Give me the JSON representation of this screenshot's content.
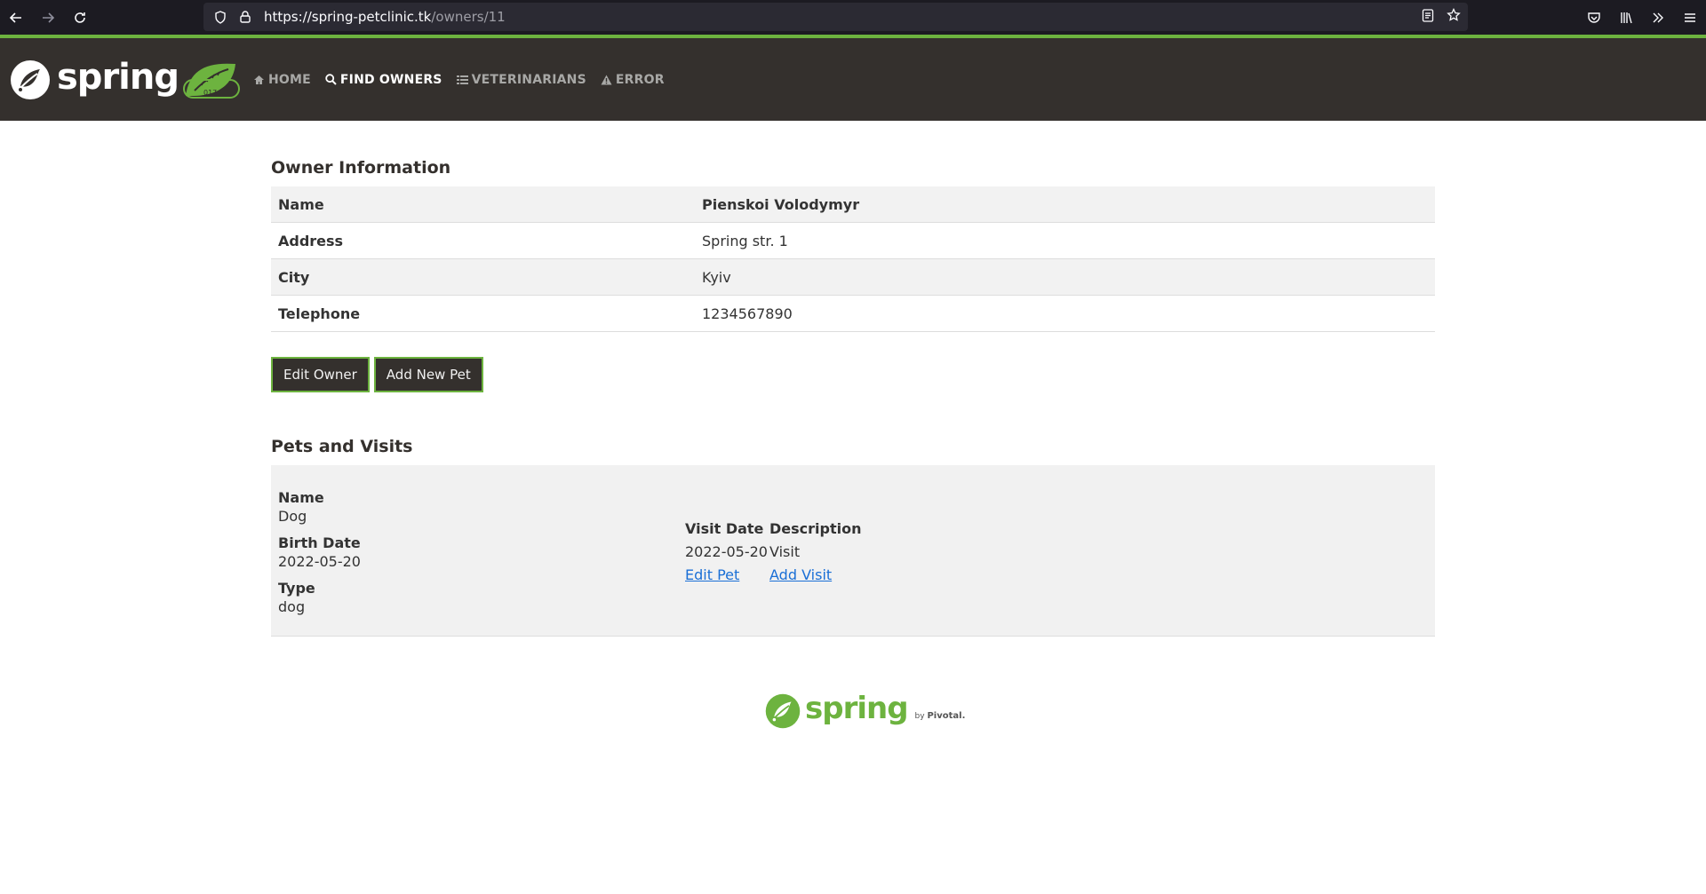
{
  "browser": {
    "url_host": "https://spring-petclinic.tk",
    "url_path": "/owners/11"
  },
  "brand": {
    "logo_text": "spring",
    "badge_text": "017"
  },
  "nav": {
    "items": [
      {
        "label": "HOME",
        "icon": "home-icon"
      },
      {
        "label": "FIND OWNERS",
        "icon": "search-icon",
        "active": true
      },
      {
        "label": "VETERINARIANS",
        "icon": "list-icon"
      },
      {
        "label": "ERROR",
        "icon": "warning-icon"
      }
    ]
  },
  "owner": {
    "title": "Owner Information",
    "rows": [
      {
        "key": "Name",
        "value": "Pienskoi Volodymyr"
      },
      {
        "key": "Address",
        "value": "Spring str. 1"
      },
      {
        "key": "City",
        "value": "Kyiv"
      },
      {
        "key": "Telephone",
        "value": "1234567890"
      }
    ],
    "edit_button": "Edit Owner",
    "add_pet_button": "Add New Pet"
  },
  "pets": {
    "title": "Pets and Visits",
    "name_label": "Name",
    "name": "Dog",
    "birth_label": "Birth Date",
    "birth": "2022-05-20",
    "type_label": "Type",
    "type": "dog",
    "visit_date_header": "Visit Date",
    "description_header": "Description",
    "visit_date": "2022-05-20",
    "visit_description": "Visit",
    "edit_pet_link": "Edit Pet",
    "add_visit_link": "Add Visit"
  },
  "footer": {
    "logo_text": "spring",
    "by_text": "by",
    "pivotal_text": "Pivotal."
  },
  "colors": {
    "brand_green": "#6db33f",
    "navbar_bg": "#34302d",
    "link_blue": "#1a6fd6"
  }
}
